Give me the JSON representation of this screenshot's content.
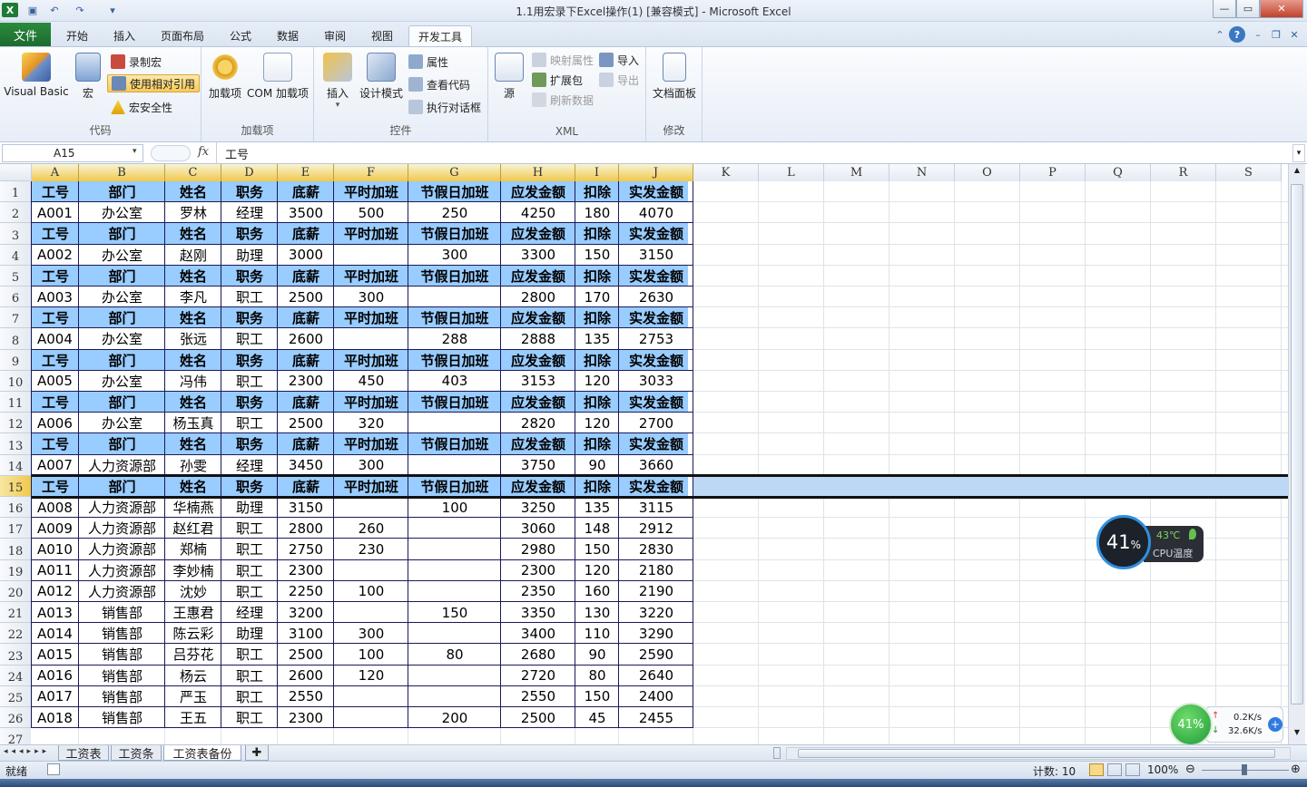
{
  "window": {
    "title": "1.1用宏录下Excel操作(1)  [兼容模式] - Microsoft Excel"
  },
  "ribbon_tabs": [
    "文件",
    "开始",
    "插入",
    "页面布局",
    "公式",
    "数据",
    "审阅",
    "视图",
    "开发工具"
  ],
  "active_tab": "开发工具",
  "ribbon": {
    "code": {
      "label": "代码",
      "visual_basic": "Visual Basic",
      "macros": "宏",
      "record_macro": "录制宏",
      "relative_ref": "使用相对引用",
      "macro_security": "宏安全性"
    },
    "addins": {
      "label": "加载项",
      "addins": "加载项",
      "com_addins": "COM 加载项"
    },
    "controls": {
      "label": "控件",
      "insert": "插入",
      "design_mode": "设计模式",
      "properties": "属性",
      "view_code": "查看代码",
      "run_dialog": "执行对话框"
    },
    "xml": {
      "label": "XML",
      "source": "源",
      "map_props": "映射属性",
      "expansion_packs": "扩展包",
      "refresh_data": "刷新数据",
      "import": "导入",
      "export": "导出"
    },
    "modify": {
      "label": "修改",
      "document_panel": "文档面板"
    }
  },
  "formula_bar": {
    "name_box": "A15",
    "fx": "fx",
    "value": "工号"
  },
  "columns": [
    "A",
    "B",
    "C",
    "D",
    "E",
    "F",
    "G",
    "H",
    "I",
    "J",
    "K",
    "L",
    "M",
    "N",
    "O",
    "P",
    "Q",
    "R",
    "S"
  ],
  "rows": [
    "1",
    "2",
    "3",
    "4",
    "5",
    "6",
    "7",
    "8",
    "9",
    "10",
    "11",
    "12",
    "13",
    "14",
    "15",
    "16",
    "17",
    "18",
    "19",
    "20",
    "21",
    "22",
    "23",
    "24",
    "25",
    "26",
    "27"
  ],
  "header_labels": [
    "工号",
    "部门",
    "姓名",
    "职务",
    "底薪",
    "平时加班",
    "节假日加班",
    "应发金额",
    "扣除",
    "实发金额"
  ],
  "records": [
    [
      "A001",
      "办公室",
      "罗林",
      "经理",
      "3500",
      "500",
      "250",
      "4250",
      "180",
      "4070"
    ],
    [
      "A002",
      "办公室",
      "赵刚",
      "助理",
      "3000",
      "",
      "300",
      "3300",
      "150",
      "3150"
    ],
    [
      "A003",
      "办公室",
      "李凡",
      "职工",
      "2500",
      "300",
      "",
      "2800",
      "170",
      "2630"
    ],
    [
      "A004",
      "办公室",
      "张远",
      "职工",
      "2600",
      "",
      "288",
      "2888",
      "135",
      "2753"
    ],
    [
      "A005",
      "办公室",
      "冯伟",
      "职工",
      "2300",
      "450",
      "403",
      "3153",
      "120",
      "3033"
    ],
    [
      "A006",
      "办公室",
      "杨玉真",
      "职工",
      "2500",
      "320",
      "",
      "2820",
      "120",
      "2700"
    ],
    [
      "A007",
      "人力资源部",
      "孙雯",
      "经理",
      "3450",
      "300",
      "",
      "3750",
      "90",
      "3660"
    ],
    [
      "A008",
      "人力资源部",
      "华楠燕",
      "助理",
      "3150",
      "",
      "100",
      "3250",
      "135",
      "3115"
    ],
    [
      "A009",
      "人力资源部",
      "赵红君",
      "职工",
      "2800",
      "260",
      "",
      "3060",
      "148",
      "2912"
    ],
    [
      "A010",
      "人力资源部",
      "郑楠",
      "职工",
      "2750",
      "230",
      "",
      "2980",
      "150",
      "2830"
    ],
    [
      "A011",
      "人力资源部",
      "李妙楠",
      "职工",
      "2300",
      "",
      "",
      "2300",
      "120",
      "2180"
    ],
    [
      "A012",
      "人力资源部",
      "沈妙",
      "职工",
      "2250",
      "100",
      "",
      "2350",
      "160",
      "2190"
    ],
    [
      "A013",
      "销售部",
      "王惠君",
      "经理",
      "3200",
      "",
      "150",
      "3350",
      "130",
      "3220"
    ],
    [
      "A014",
      "销售部",
      "陈云彩",
      "助理",
      "3100",
      "300",
      "",
      "3400",
      "110",
      "3290"
    ],
    [
      "A015",
      "销售部",
      "吕芬花",
      "职工",
      "2500",
      "100",
      "80",
      "2680",
      "90",
      "2590"
    ],
    [
      "A016",
      "销售部",
      "杨云",
      "职工",
      "2600",
      "120",
      "",
      "2720",
      "80",
      "2640"
    ],
    [
      "A017",
      "销售部",
      "严玉",
      "职工",
      "2550",
      "",
      "",
      "2550",
      "150",
      "2400"
    ],
    [
      "A018",
      "销售部",
      "王五",
      "职工",
      "2300",
      "",
      "200",
      "2500",
      "45",
      "2455"
    ]
  ],
  "sheet_tabs": [
    "工资表",
    "工资条",
    "工资表备份"
  ],
  "active_sheet": "工资表备份",
  "status": {
    "ready": "就绪",
    "count": "计数: 10",
    "zoom": "100%"
  },
  "cpu_widget": {
    "percent": "41",
    "unit": "%",
    "temp": "43℃",
    "label": "CPU温度"
  },
  "net_widget": {
    "percent": "41%",
    "up": "0.2K/s",
    "down": "32.6K/s"
  }
}
